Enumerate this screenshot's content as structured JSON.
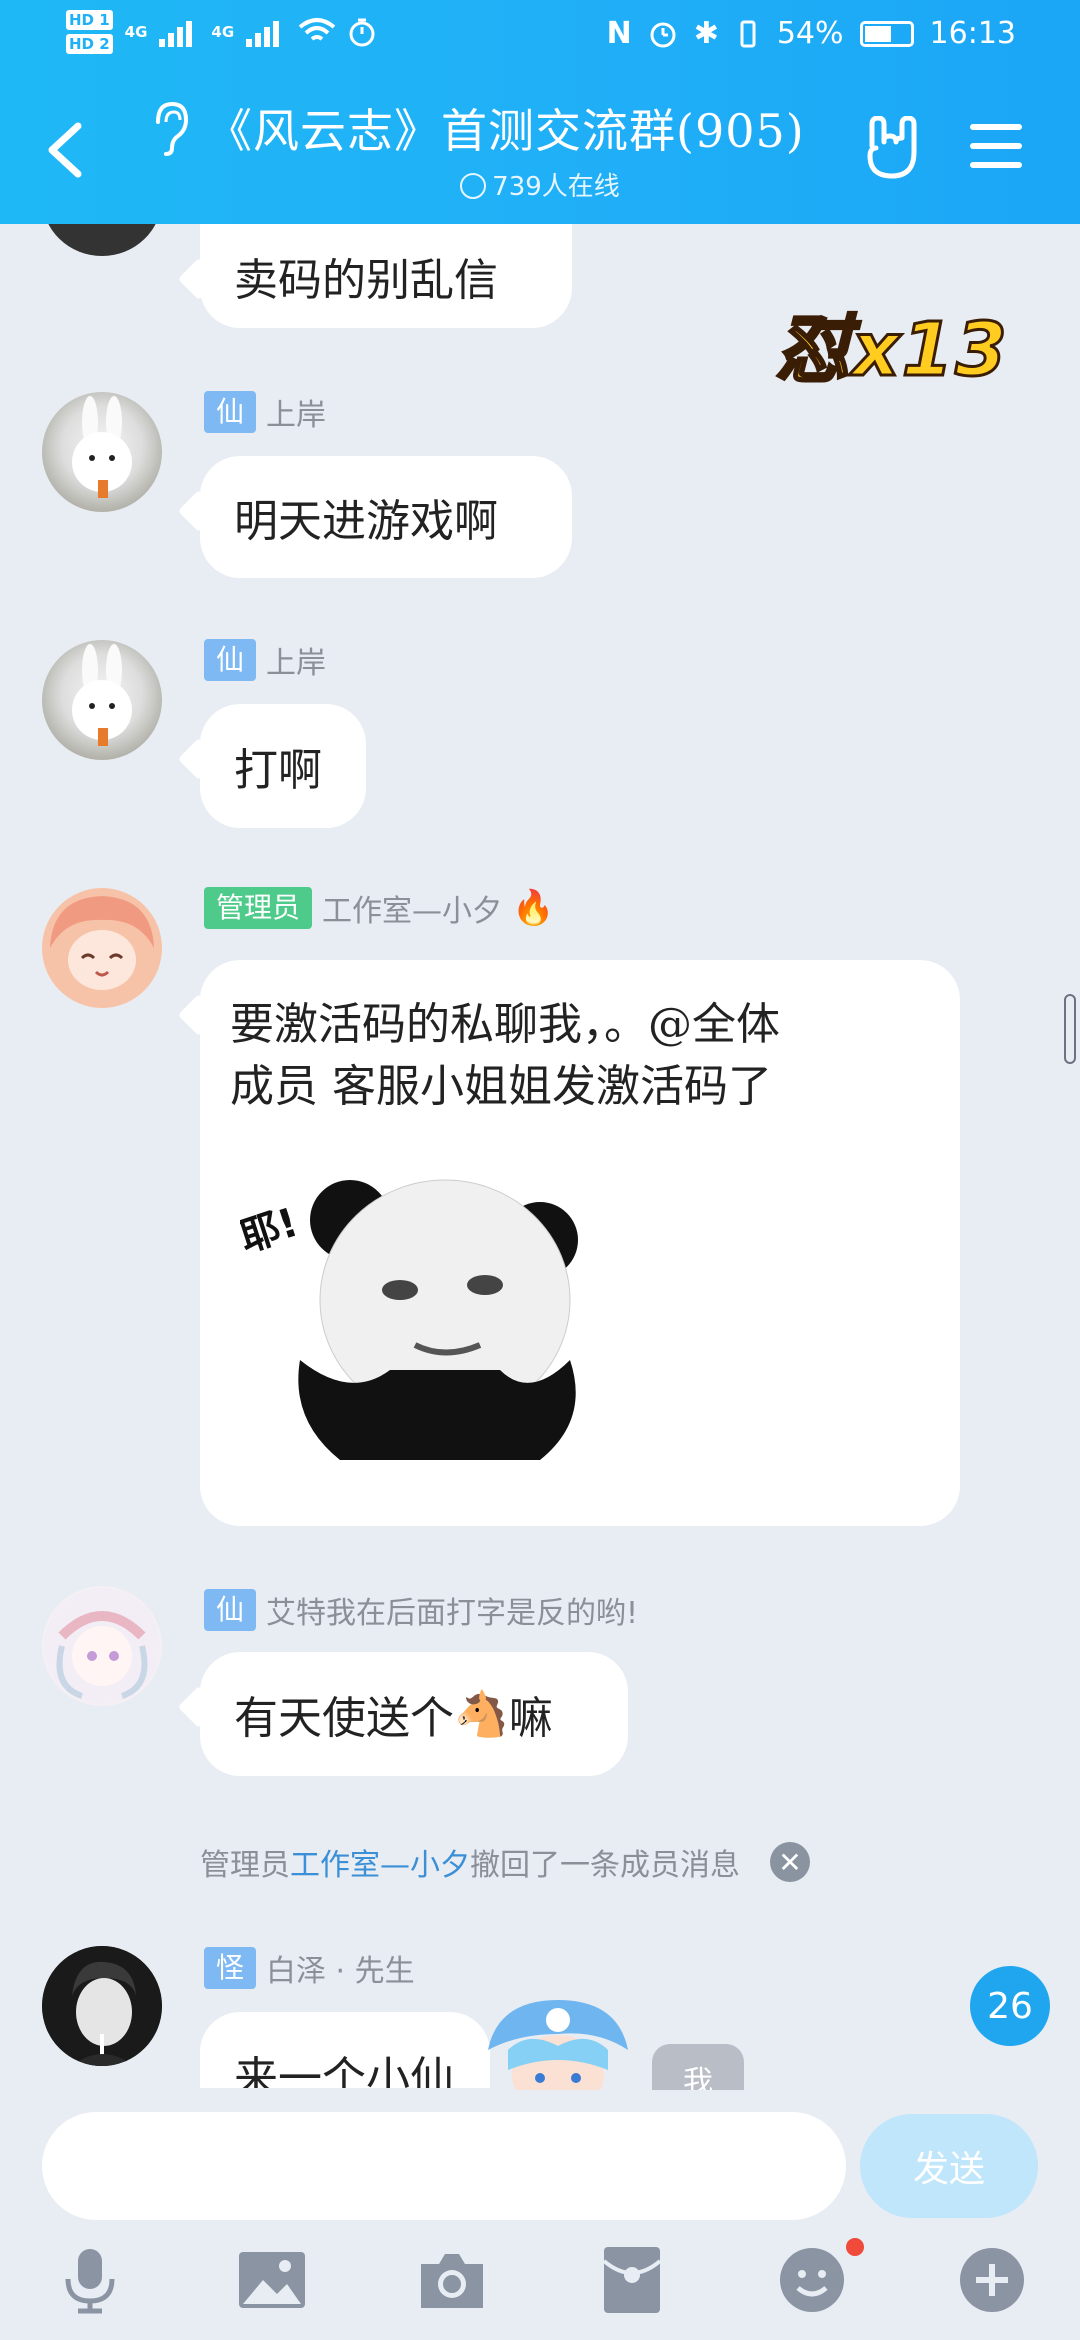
{
  "status_bar": {
    "hd1": "HD 1",
    "hd2": "HD 2",
    "net1": "4G",
    "net2": "4G",
    "battery": "54%",
    "time": "16:13"
  },
  "header": {
    "title": "《风云志》首测交流群(905)",
    "online": "739人在线"
  },
  "combo": "怼x13",
  "messages": [
    {
      "name": "",
      "tag": "",
      "text": "卖码的别乱信"
    },
    {
      "name": "上岸",
      "tag": "仙",
      "text": "明天进游戏啊"
    },
    {
      "name": "上岸",
      "tag": "仙",
      "text": "打啊"
    },
    {
      "name": "工作室—小夕",
      "tag": "管理员",
      "text_line1": "要激活码的私聊我，。@全体",
      "text_line2": "成员  客服小姐姐发激活码了",
      "sticker_caption": "耶!"
    },
    {
      "name": "艾特我在后面打字是反的哟!",
      "tag": "仙",
      "text_a": "有天使送个",
      "text_b": "嘛"
    },
    {
      "name": "白泽 · 先生",
      "tag": "怪",
      "text": "来一个小仙",
      "mini_tag": "我"
    }
  ],
  "system": {
    "prefix": "管理员",
    "actor": "工作室—小夕",
    "suffix": "撤回了一条成员消息"
  },
  "unread_count": "26",
  "input": {
    "placeholder": "",
    "send_label": "发送"
  },
  "toolbar": [
    "mic-icon",
    "image-icon",
    "camera-icon",
    "redpacket-icon",
    "emoji-icon",
    "plus-icon"
  ],
  "colors": {
    "header": "#1fb0f6",
    "accent_link": "#3b8fd6",
    "send_disabled": "#bfe6fb",
    "badge": "#1fa6ee"
  }
}
